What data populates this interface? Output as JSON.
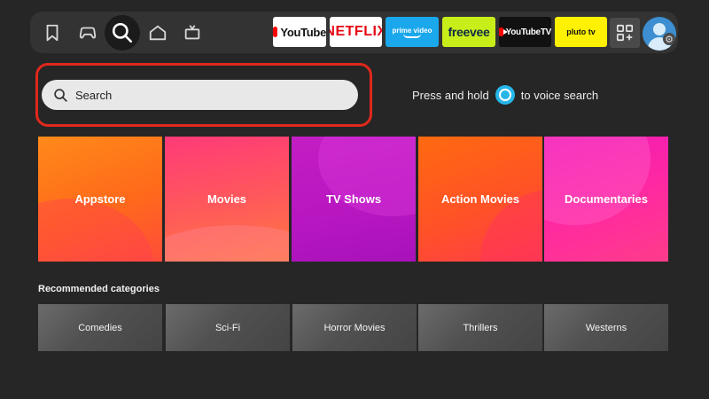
{
  "nav": {
    "icons": [
      "bookmark-icon",
      "gamepad-icon",
      "search-icon",
      "home-icon",
      "tv-icon"
    ],
    "active": "search-icon"
  },
  "apps": [
    {
      "name": "YouTube",
      "bg": "#ffffff"
    },
    {
      "name": "NETFLIX",
      "bg": "#ffffff"
    },
    {
      "name": "prime video",
      "bg": "#1aa7ec"
    },
    {
      "name": "freevee",
      "bg": "#c8ee1a"
    },
    {
      "name": "YouTubeTV",
      "bg": "#111111"
    },
    {
      "name": "pluto tv",
      "bg": "#fff200"
    }
  ],
  "search": {
    "placeholder": "Search",
    "voice_hint_before": "Press and hold",
    "voice_hint_after": "to voice search"
  },
  "categories": [
    {
      "label": "Appstore"
    },
    {
      "label": "Movies"
    },
    {
      "label": "TV Shows"
    },
    {
      "label": "Action Movies"
    },
    {
      "label": "Documentaries"
    }
  ],
  "recommended": {
    "title": "Recommended categories",
    "items": [
      "Comedies",
      "Sci-Fi",
      "Horror Movies",
      "Thrillers",
      "Westerns"
    ]
  },
  "colors": {
    "focus": "#e0281c",
    "alexa": "#26b6e8"
  }
}
